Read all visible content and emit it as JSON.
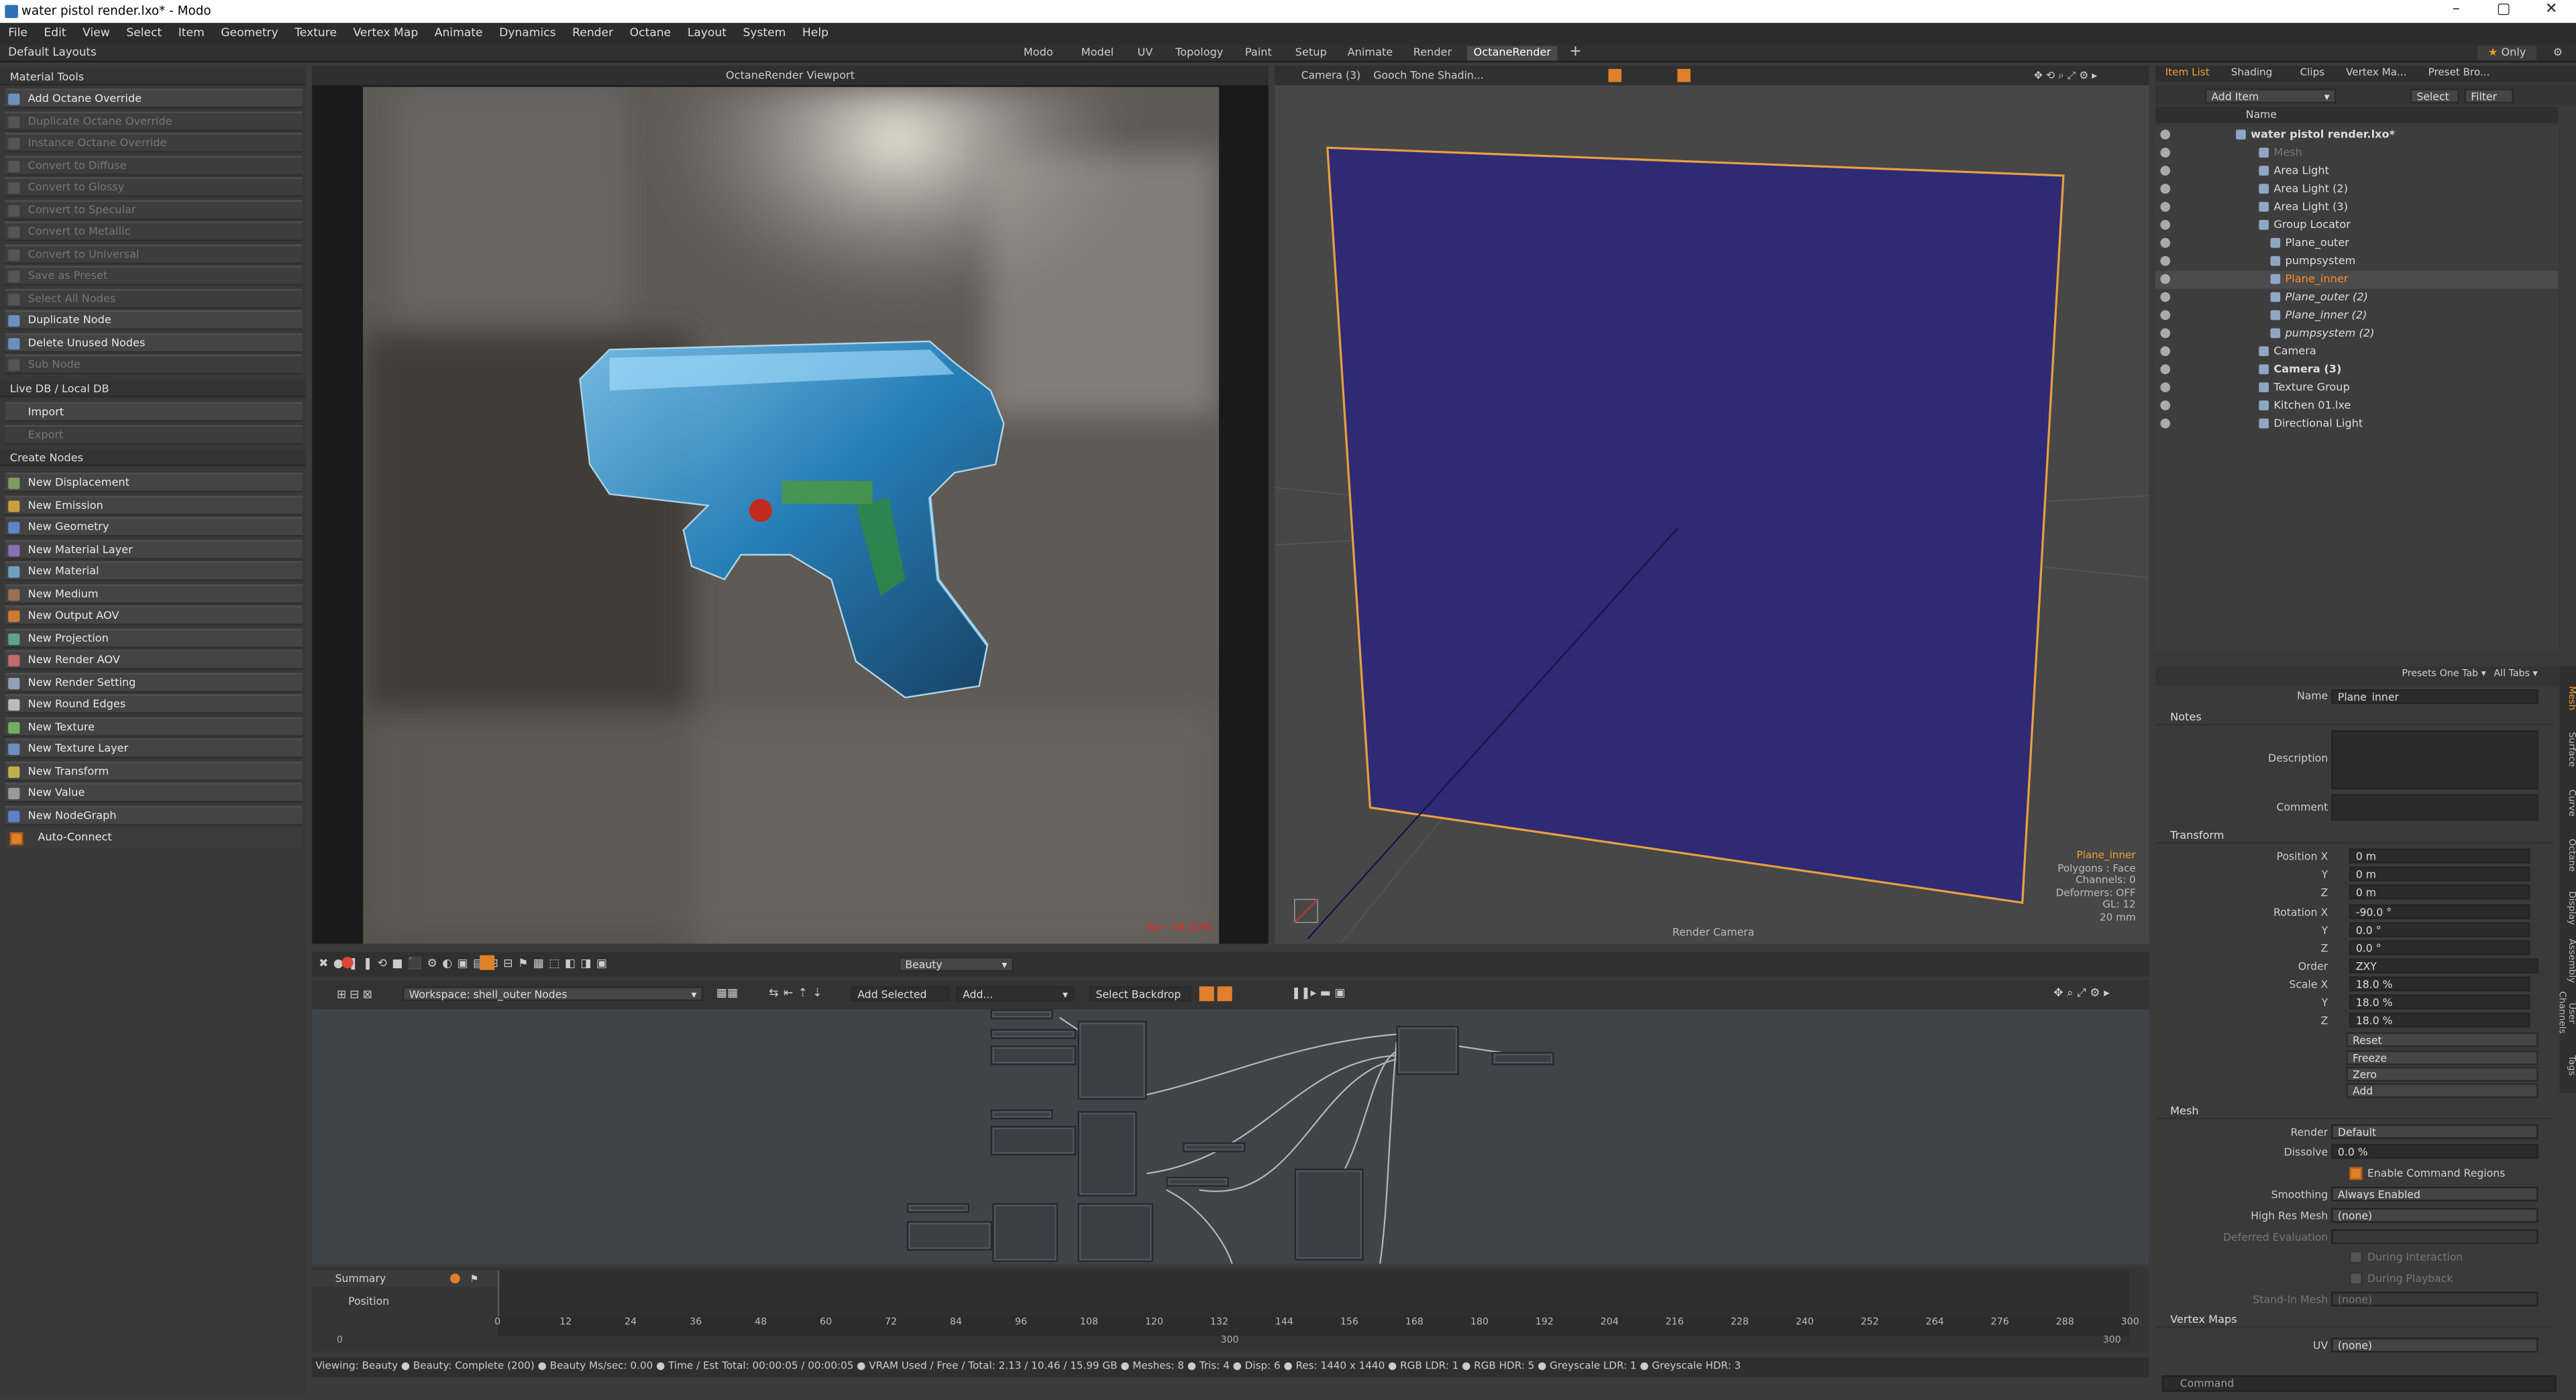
{
  "window": {
    "title": "water pistol render.lxo* - Modo",
    "min": "–",
    "max": "▢",
    "close": "✕"
  },
  "menu": [
    "File",
    "Edit",
    "View",
    "Select",
    "Item",
    "Geometry",
    "Texture",
    "Vertex Map",
    "Animate",
    "Dynamics",
    "Render",
    "Octane",
    "Layout",
    "System",
    "Help"
  ],
  "layout": {
    "default_layouts": "Default Layouts",
    "tabs": [
      "Modo",
      "Model",
      "UV",
      "Topology",
      "Paint",
      "Setup",
      "Animate",
      "Render",
      "OctaneRender"
    ],
    "active_tab": "OctaneRender",
    "add": "+",
    "only": "Only"
  },
  "left_panel": {
    "material_tools_title": "Material Tools",
    "material_tools": [
      {
        "label": "Add Octane Override",
        "enabled": true
      },
      {
        "label": "Duplicate Octane Override",
        "enabled": false
      },
      {
        "label": "Instance Octane Override",
        "enabled": false
      },
      {
        "label": "Convert to Diffuse",
        "enabled": false
      },
      {
        "label": "Convert to Glossy",
        "enabled": false
      },
      {
        "label": "Convert to Specular",
        "enabled": false
      },
      {
        "label": "Convert to Metallic",
        "enabled": false
      },
      {
        "label": "Convert to Universal",
        "enabled": false
      },
      {
        "label": "Save as Preset",
        "enabled": false
      },
      {
        "label": "Select All Nodes",
        "enabled": false
      },
      {
        "label": "Duplicate Node",
        "enabled": true
      },
      {
        "label": "Delete Unused Nodes",
        "enabled": true
      },
      {
        "label": "Sub Node",
        "enabled": false
      }
    ],
    "livedb_title": "Live DB / Local DB",
    "livedb": [
      {
        "label": "Import",
        "enabled": true
      },
      {
        "label": "Export",
        "enabled": false
      }
    ],
    "create_nodes_title": "Create Nodes",
    "create_nodes": [
      "New Displacement",
      "New Emission",
      "New Geometry",
      "New Material Layer",
      "New Material",
      "New Medium",
      "New Output AOV",
      "New Projection",
      "New Render AOV",
      "New Render Setting",
      "New Round Edges",
      "New Texture",
      "New Texture Layer",
      "New Transform",
      "New Value",
      "New NodeGraph"
    ],
    "auto_connect": "Auto-Connect"
  },
  "octane_viewport": {
    "title": "OctaneRender Viewport",
    "progress": "Sa - 19.10%"
  },
  "viewport3d": {
    "camera": "Camera (3)",
    "shading": "Gooch Tone Shadin...",
    "info": [
      "Plane_inner",
      "Polygons : Face",
      "Channels: 0",
      "Deformers: OFF",
      "GL: 12",
      "20 mm"
    ],
    "render_camera": "Render Camera"
  },
  "render_toolbar": {
    "pass": "Beauty"
  },
  "node_editor": {
    "workspace": "Workspace: shell_outer Nodes",
    "add_selected": "Add Selected",
    "add": "Add...",
    "select_backdrop": "Select Backdrop"
  },
  "timeline": {
    "summary": "Summary",
    "position": "Position",
    "ticks": [
      "0",
      "12",
      "24",
      "36",
      "48",
      "60",
      "72",
      "84",
      "96",
      "108",
      "120",
      "132",
      "144",
      "156",
      "168",
      "180",
      "192",
      "204",
      "216",
      "228",
      "240",
      "252",
      "264",
      "276",
      "288",
      "300"
    ],
    "range_start": "0",
    "range_mid": "300",
    "range_end": "300"
  },
  "status": "Viewing: Beauty ● Beauty: Complete (200) ● Beauty Ms/sec: 0.00 ● Time / Est Total: 00:00:05 / 00:00:05 ● VRAM Used / Free / Total: 2.13 / 10.46 / 15.99 GB ● Meshes: 8 ● Tris: 4 ● Disp: 6 ● Res: 1440 x 1440 ● RGB LDR: 1 ● RGB HDR: 5 ● Greyscale LDR: 1 ● Greyscale HDR: 3",
  "right_panel": {
    "tabs": [
      "Item List",
      "Shading",
      "Clips",
      "Vertex Ma...",
      "Preset Bro..."
    ],
    "add_item": "Add Item",
    "select": "Select",
    "filter": "Filter",
    "name_col": "Name",
    "tree": [
      {
        "label": "water pistol render.lxo*",
        "indent": 0,
        "bold": true,
        "dim": false,
        "sel": false
      },
      {
        "label": "Mesh",
        "indent": 2,
        "dim": true,
        "sel": false
      },
      {
        "label": "Area Light",
        "indent": 2,
        "dim": false,
        "sel": false
      },
      {
        "label": "Area Light (2)",
        "indent": 2,
        "dim": false,
        "sel": false
      },
      {
        "label": "Area Light (3)",
        "indent": 2,
        "dim": false,
        "sel": false
      },
      {
        "label": "Group Locator",
        "indent": 2,
        "dim": false,
        "sel": false
      },
      {
        "label": "Plane_outer",
        "indent": 3,
        "dim": false,
        "sel": false
      },
      {
        "label": "pumpsystem",
        "indent": 3,
        "dim": false,
        "sel": false
      },
      {
        "label": "Plane_inner",
        "indent": 3,
        "dim": false,
        "sel": true
      },
      {
        "label": "Plane_outer (2)",
        "indent": 3,
        "dim": false,
        "italic": true,
        "sel": false
      },
      {
        "label": "Plane_inner (2)",
        "indent": 3,
        "dim": false,
        "italic": true,
        "sel": false
      },
      {
        "label": "pumpsystem (2)",
        "indent": 3,
        "dim": false,
        "italic": true,
        "sel": false
      },
      {
        "label": "Camera",
        "indent": 2,
        "dim": false,
        "sel": false
      },
      {
        "label": "Camera (3)",
        "indent": 2,
        "bold": true,
        "dim": false,
        "sel": false
      },
      {
        "label": "Texture Group",
        "indent": 2,
        "dim": false,
        "sel": false
      },
      {
        "label": "Kitchen 01.lxe",
        "indent": 2,
        "dim": false,
        "sel": false
      },
      {
        "label": "Directional Light",
        "indent": 2,
        "dim": false,
        "sel": false
      }
    ],
    "props_header": {
      "presets": "Presets",
      "one_tab": "One Tab ▾",
      "all_tabs": "All Tabs ▾"
    },
    "name_label": "Name",
    "name_value": "Plane_inner",
    "notes": "Notes",
    "description": "Description",
    "comment": "Comment",
    "transform": "Transform",
    "position_x_label": "Position X",
    "y_label": "Y",
    "z_label": "Z",
    "position": [
      "0 m",
      "0 m",
      "0 m"
    ],
    "rotation_x_label": "Rotation X",
    "rotation": [
      "-90.0 °",
      "0.0 °",
      "0.0 °"
    ],
    "order_label": "Order",
    "order": "ZXY",
    "scale_x_label": "Scale X",
    "scale": [
      "18.0 %",
      "18.0 %",
      "18.0 %"
    ],
    "transform_buttons": [
      "Reset",
      "Freeze",
      "Zero",
      "Add"
    ],
    "mesh": "Mesh",
    "render_label": "Render",
    "render_value": "Default",
    "dissolve_label": "Dissolve",
    "dissolve_value": "0.0 %",
    "enable_cmd": "Enable Command Regions",
    "smoothing_label": "Smoothing",
    "smoothing_value": "Always Enabled",
    "hires_label": "High Res Mesh",
    "hires_value": "(none)",
    "deferred_label": "Deferred Evaluation",
    "during_interaction": "During Interaction",
    "during_playback": "During Playback",
    "standin_label": "Stand-In Mesh",
    "standin_value": "(none)",
    "vertex_maps": "Vertex Maps",
    "uv_label": "UV",
    "uv_value": "(none)",
    "side_tabs": [
      "Mesh",
      "Surface",
      "Curve",
      "Octane",
      "Display",
      "Assembly",
      "User Channels",
      "Tags"
    ],
    "command": "Command"
  },
  "colors": {
    "accent": "#f0901e",
    "plane": "#2e2b74",
    "selection": "#ff8c22"
  }
}
